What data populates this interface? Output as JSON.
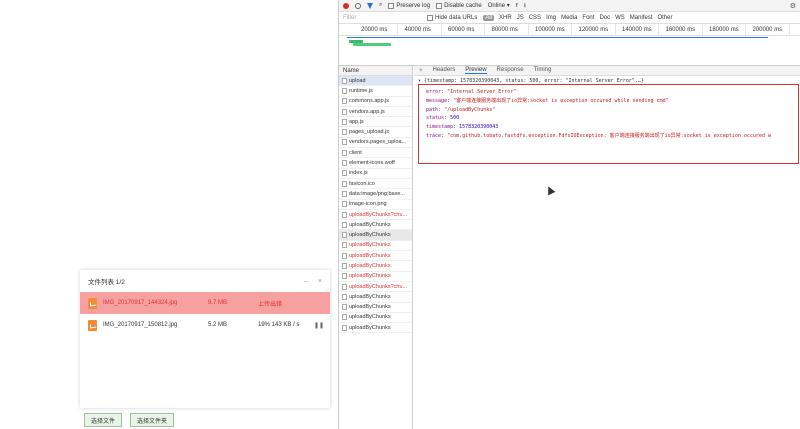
{
  "upload_panel": {
    "title": "文件列表 1/2",
    "files": [
      {
        "name": "IMG_20170917_144324.jpg",
        "size": "9.7 MB",
        "status": "上传出错",
        "error": true
      },
      {
        "name": "IMG_20170917_150812.jpg",
        "size": "5.2 MB",
        "status": "19% 143 KB / s",
        "error": false
      }
    ],
    "pause_symbol": "❚❚",
    "buttons": {
      "choose_file": "选择文件",
      "choose_folder": "选择文件夹"
    }
  },
  "devtools": {
    "toolbar": {
      "preserve_log": "Preserve log",
      "disable_cache": "Disable cache",
      "throttle": "Online"
    },
    "filter": {
      "placeholder": "Filter",
      "hide_data_urls": "Hide data URLs",
      "types": [
        "All",
        "XHR",
        "JS",
        "CSS",
        "Img",
        "Media",
        "Font",
        "Doc",
        "WS",
        "Manifest",
        "Other"
      ]
    },
    "timeline_ticks": [
      "20000 ms",
      "40000 ms",
      "60000 ms",
      "80000 ms",
      "100000 ms",
      "120000 ms",
      "140000 ms",
      "160000 ms",
      "180000 ms",
      "200000 ms"
    ],
    "names_header": "Name",
    "requests": [
      {
        "name": "upload",
        "state": "sel"
      },
      {
        "name": "runtime.js",
        "state": ""
      },
      {
        "name": "commons.app.js",
        "state": ""
      },
      {
        "name": "vendors.app.js",
        "state": ""
      },
      {
        "name": "app.js",
        "state": ""
      },
      {
        "name": "pages_upload.js",
        "state": ""
      },
      {
        "name": "vendors.pages_uploa...",
        "state": ""
      },
      {
        "name": "client",
        "state": ""
      },
      {
        "name": "element-icons.woff",
        "state": ""
      },
      {
        "name": "index.js",
        "state": ""
      },
      {
        "name": "favicon.ico",
        "state": ""
      },
      {
        "name": "data:image/png;base...",
        "state": ""
      },
      {
        "name": "image-icon.png",
        "state": ""
      },
      {
        "name": "uploadByChunks?chu...",
        "state": "red"
      },
      {
        "name": "uploadByChunks",
        "state": ""
      },
      {
        "name": "uploadByChunks",
        "state": "grey"
      },
      {
        "name": "uploadByChunks",
        "state": "red"
      },
      {
        "name": "uploadByChunks",
        "state": "red"
      },
      {
        "name": "uploadByChunks",
        "state": "red"
      },
      {
        "name": "uploadByChunks",
        "state": "red"
      },
      {
        "name": "uploadByChunks?chu...",
        "state": "red"
      },
      {
        "name": "uploadByChunks",
        "state": ""
      },
      {
        "name": "uploadByChunks",
        "state": ""
      },
      {
        "name": "uploadByChunks",
        "state": ""
      },
      {
        "name": "uploadByChunks",
        "state": ""
      }
    ],
    "detail_tabs": [
      "Headers",
      "Preview",
      "Response",
      "Timing"
    ],
    "active_tab": "Preview",
    "response_summary": "▾ {timestamp: 1578320390043, status: 500, error: \"Internal Server Error\",…}",
    "response_fields": [
      {
        "key": "error",
        "value": "\"Internal Server Error\"",
        "type": "string"
      },
      {
        "key": "message",
        "value": "\"客户端连接服务端出现了io异常:socket is exception occured while sending cmd\"",
        "type": "string"
      },
      {
        "key": "path",
        "value": "\"/uploadByChunks\"",
        "type": "string"
      },
      {
        "key": "status",
        "value": "500",
        "type": "number"
      },
      {
        "key": "timestamp",
        "value": "1578320390043",
        "type": "number"
      },
      {
        "key": "trace",
        "value": "\"com.github.tobato.fastdfs.exception.FdfsIOException: 客户端连接服务端出现了io异常:socket is exception occured w",
        "type": "string"
      }
    ]
  }
}
